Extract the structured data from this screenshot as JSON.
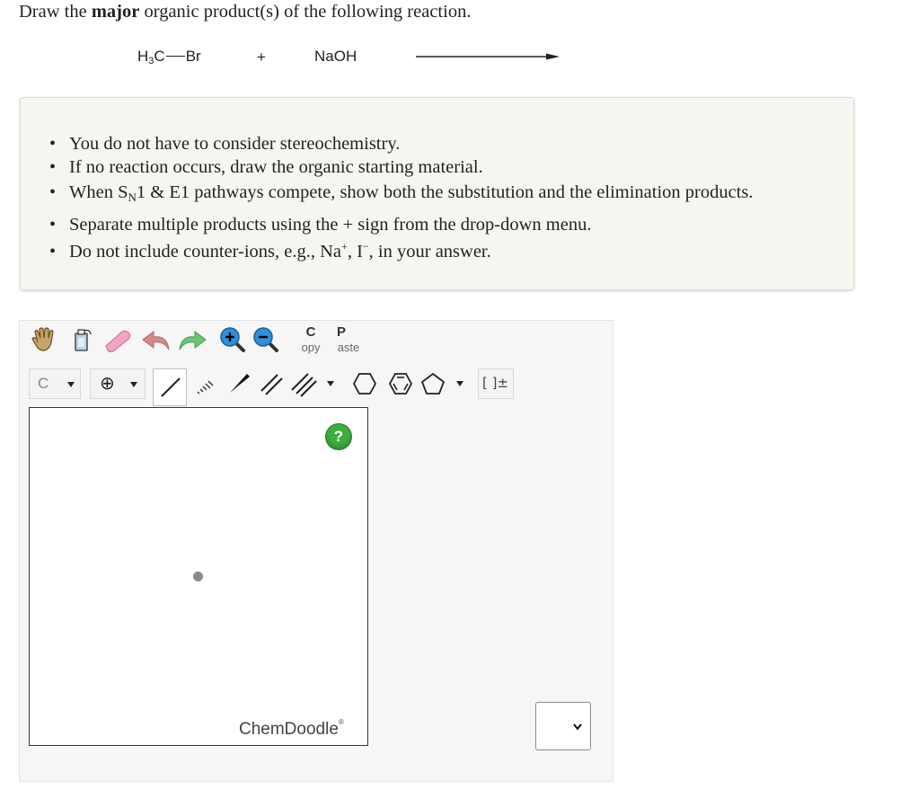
{
  "question": {
    "prefix": "Draw the",
    "emphasis": "major",
    "suffix": "organic product(s) of the following reaction."
  },
  "reaction": {
    "reactant_left": "H",
    "reactant_sub": "3",
    "reactant_c": "C",
    "reactant_right": "Br",
    "plus": "+",
    "reagent": "NaOH"
  },
  "notes": {
    "item1": "You do not have to consider stereochemistry.",
    "item2": "If no reaction occurs, draw the organic starting material.",
    "item3_a": "When S",
    "item3_sub": "N",
    "item3_b": "1 & E1 pathways compete, show both the substitution and the elimination products.",
    "item4": "Separate multiple products using the + sign from the drop-down menu.",
    "item5_a": "Do not include counter-ions, e.g., Na",
    "item5_sup1": "+",
    "item5_b": ", I",
    "item5_sup2": "−",
    "item5_c": ", in your answer."
  },
  "toolbar": {
    "copy_top": "C",
    "copy_bottom": "opy",
    "paste_top": "P",
    "paste_bottom": "aste",
    "carbon_label": "C",
    "charge_label": "⊕",
    "bracket_label": "[ ]±"
  },
  "editor": {
    "help_label": "?",
    "brand": "ChemDoodle",
    "brand_mark": "®"
  }
}
